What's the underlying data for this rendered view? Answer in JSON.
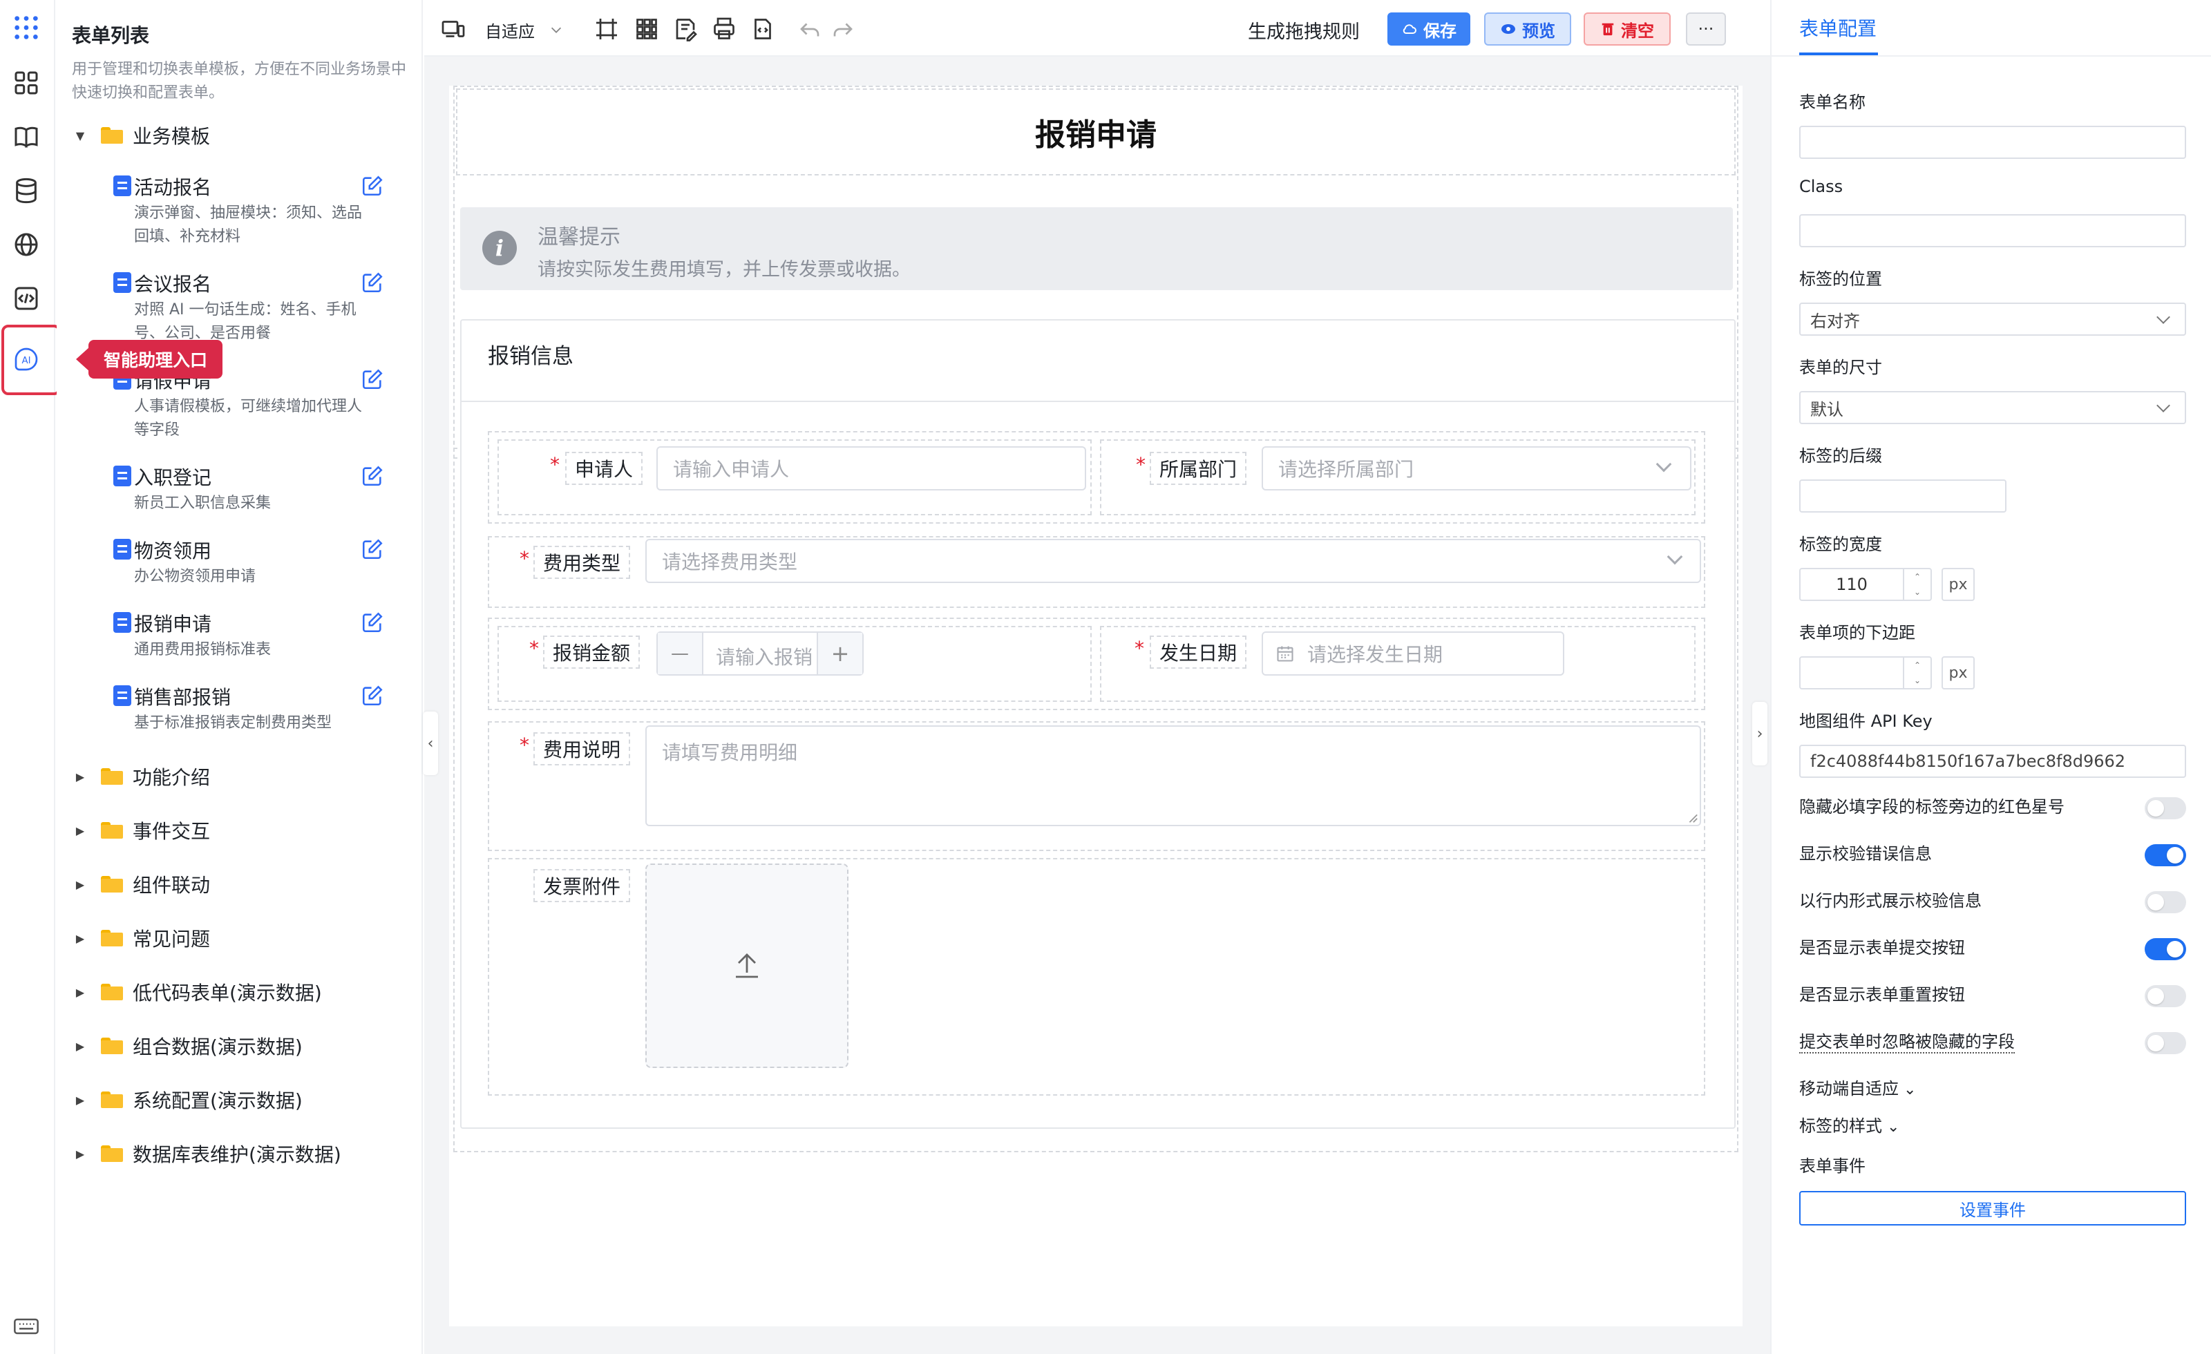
{
  "callout": "智能助理入口",
  "list_panel": {
    "title": "表单列表",
    "description": "用于管理和切换表单模板，方便在不同业务场景中快速切换和配置表单。",
    "open_folder": "业务模板",
    "templates": [
      {
        "name": "活动报名",
        "desc": "演示弹窗、抽屉模块：须知、选品回填、补充材料"
      },
      {
        "name": "会议报名",
        "desc": "对照 AI 一句话生成：姓名、手机号、公司、是否用餐"
      },
      {
        "name": "请假申请",
        "desc": "人事请假模板，可继续增加代理人等字段"
      },
      {
        "name": "入职登记",
        "desc": "新员工入职信息采集"
      },
      {
        "name": "物资领用",
        "desc": "办公物资领用申请"
      },
      {
        "name": "报销申请",
        "desc": "通用费用报销标准表"
      },
      {
        "name": "销售部报销",
        "desc": "基于标准报销表定制费用类型"
      }
    ],
    "folders": [
      "功能介绍",
      "事件交互",
      "组件联动",
      "常见问题",
      "低代码表单(演示数据)",
      "组合数据(演示数据)",
      "系统配置(演示数据)",
      "数据库表维护(演示数据)"
    ]
  },
  "toolbar": {
    "device_mode": "自适应",
    "rule_link": "生成拖拽规则",
    "save": "保存",
    "preview": "预览",
    "clear": "清空",
    "more": "···"
  },
  "form": {
    "title": "报销申请",
    "tip_title": "温馨提示",
    "tip_text": "请按实际发生费用填写，并上传发票或收据。",
    "section_title": "报销信息",
    "required_mark": "*",
    "fields": {
      "applicant_label": "申请人",
      "applicant_placeholder": "请输入申请人",
      "dept_label": "所属部门",
      "dept_placeholder": "请选择所属部门",
      "type_label": "费用类型",
      "type_placeholder": "请选择费用类型",
      "amount_label": "报销金额",
      "amount_placeholder": "请输入报销",
      "date_label": "发生日期",
      "date_placeholder": "请选择发生日期",
      "desc_label": "费用说明",
      "desc_placeholder": "请填写费用明细",
      "attach_label": "发票附件"
    },
    "minus": "—",
    "plus": "+"
  },
  "config": {
    "tab": "表单配置",
    "form_name_label": "表单名称",
    "form_name_value": "",
    "class_label": "Class",
    "class_value": "",
    "label_position_label": "标签的位置",
    "label_position_value": "右对齐",
    "form_size_label": "表单的尺寸",
    "form_size_value": "默认",
    "label_suffix_label": "标签的后缀",
    "label_suffix_value": "",
    "label_width_label": "标签的宽度",
    "label_width_value": "110",
    "unit": "px",
    "item_margin_label": "表单项的下边距",
    "item_margin_value": "",
    "map_key_label": "地图组件 API Key",
    "map_key_value": "f2c4088f44b8150f167a7bec8f8d9662",
    "toggles": [
      {
        "label": "隐藏必填字段的标签旁边的红色星号",
        "on": false
      },
      {
        "label": "显示校验错误信息",
        "on": true
      },
      {
        "label": "以行内形式展示校验信息",
        "on": false
      },
      {
        "label": "是否显示表单提交按钮",
        "on": true
      },
      {
        "label": "是否显示表单重置按钮",
        "on": false
      },
      {
        "label": "提交表单时忽略被隐藏的字段",
        "on": false
      }
    ],
    "mobile_adapt": "移动端自适应",
    "label_style": "标签的样式",
    "form_events_label": "表单事件",
    "set_events_button": "设置事件"
  },
  "colors": {
    "accent": "#1d6ff2",
    "save": "#3b82f6",
    "danger": "#e11d2c",
    "callout": "#d92948",
    "folder": "#fbc02d"
  }
}
